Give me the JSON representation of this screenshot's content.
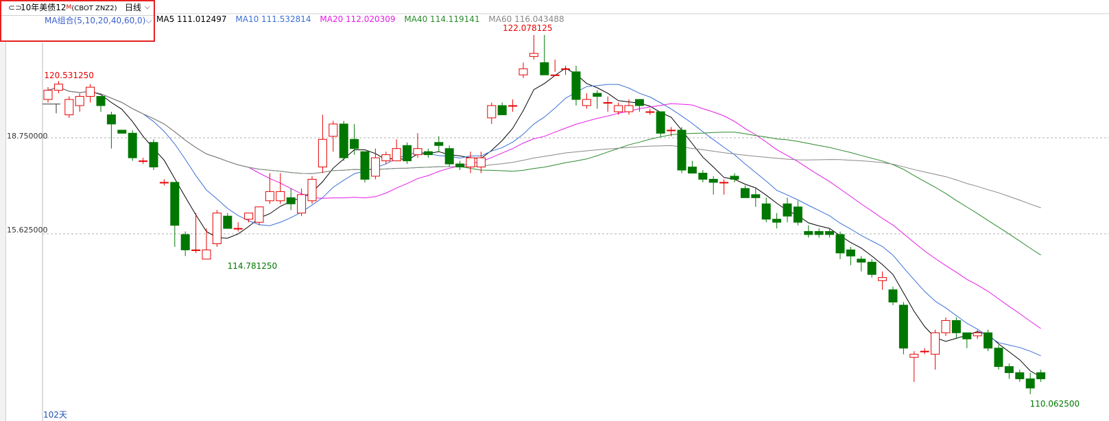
{
  "header": {
    "link_icon": "⊂⊃",
    "instrument": "10年美债12",
    "badge": "M",
    "code": "(CBOT ZNZ2)",
    "period": "日线",
    "chevron": "⌵"
  },
  "ma_combo": "MA组合(5,10,20,40,60,0)⌵",
  "ma_legend": [
    {
      "label": "MA5 111.012497",
      "color": "#000000"
    },
    {
      "label": "MA10 111.532814",
      "color": "#3a6fd8"
    },
    {
      "label": "MA20 112.020309",
      "color": "#e619e6"
    },
    {
      "label": "MA40 114.119141",
      "color": "#2a8a2a"
    },
    {
      "label": "MA60 116.043488",
      "color": "#888888"
    }
  ],
  "day_count": "102天",
  "chart_data": {
    "type": "candlestick",
    "up_color": "#e60000",
    "down_color": "#007700",
    "y_axis": {
      "ticks": [
        {
          "value": 118.75,
          "label": "18.750000"
        },
        {
          "value": 115.625,
          "label": "15.625000"
        }
      ],
      "ylim": [
        109.81,
        123.25
      ]
    },
    "annotations": {
      "high": {
        "value": 122.078125,
        "label": "122.078125",
        "index": 45
      },
      "low_left": {
        "value": 114.78125,
        "label": "114.781250",
        "index": 14
      },
      "left_marker": {
        "value": 120.53125,
        "label": "120.531250",
        "index": 1
      },
      "last_low": {
        "value": 110.0625,
        "label": "110.062500",
        "index": 94
      }
    },
    "candles": [
      [
        120.0,
        120.3,
        120.4,
        119.9
      ],
      [
        120.3,
        120.5,
        120.6,
        120.2
      ],
      [
        119.5,
        120.0,
        120.1,
        119.4
      ],
      [
        119.8,
        120.1,
        120.2,
        119.6
      ],
      [
        120.1,
        120.4,
        120.5,
        119.9
      ],
      [
        120.1,
        119.8,
        120.1,
        119.6
      ],
      [
        119.5,
        119.2,
        119.6,
        118.4
      ],
      [
        119.0,
        118.9,
        119.0,
        118.9
      ],
      [
        118.9,
        118.1,
        119.0,
        118.0
      ],
      [
        118.0,
        118.0,
        118.1,
        117.9
      ],
      [
        118.6,
        117.8,
        118.7,
        117.7
      ],
      [
        117.3,
        117.3,
        117.4,
        117.2
      ],
      [
        117.3,
        115.9,
        117.3,
        115.2
      ],
      [
        115.6,
        115.1,
        115.7,
        114.9
      ],
      [
        115.1,
        115.1,
        116.3,
        115.0
      ],
      [
        114.8,
        115.1,
        115.8,
        114.9
      ],
      [
        115.3,
        116.3,
        116.4,
        115.2
      ],
      [
        116.2,
        115.8,
        116.3,
        115.8
      ],
      [
        115.8,
        115.8,
        116.0,
        115.7
      ],
      [
        116.1,
        116.3,
        116.3,
        116.0
      ],
      [
        116.0,
        116.5,
        116.5,
        115.9
      ],
      [
        116.7,
        117.0,
        117.6,
        116.6
      ],
      [
        116.7,
        117.0,
        117.6,
        116.6
      ],
      [
        116.8,
        116.6,
        117.1,
        116.4
      ],
      [
        116.3,
        116.9,
        117.1,
        116.2
      ],
      [
        116.7,
        117.4,
        117.5,
        116.6
      ],
      [
        117.8,
        118.7,
        119.5,
        117.6
      ],
      [
        118.8,
        119.2,
        119.3,
        118.3
      ],
      [
        119.2,
        118.1,
        119.3,
        118.0
      ],
      [
        118.7,
        118.4,
        119.2,
        118.2
      ],
      [
        118.3,
        117.4,
        118.3,
        117.3
      ],
      [
        117.5,
        118.1,
        118.4,
        117.4
      ],
      [
        118.0,
        118.2,
        118.3,
        117.9
      ],
      [
        118.0,
        118.4,
        118.7,
        118.0
      ],
      [
        118.5,
        118.0,
        118.6,
        117.9
      ],
      [
        118.2,
        118.4,
        118.9,
        118.1
      ],
      [
        118.3,
        118.2,
        118.4,
        118.1
      ],
      [
        118.6,
        118.5,
        118.8,
        118.3
      ],
      [
        118.4,
        117.9,
        118.5,
        117.8
      ],
      [
        117.9,
        117.8,
        118.0,
        117.7
      ],
      [
        117.8,
        118.1,
        118.3,
        117.6
      ],
      [
        117.8,
        118.1,
        118.3,
        117.6
      ],
      [
        119.4,
        119.8,
        119.9,
        119.2
      ],
      [
        119.8,
        119.5,
        119.9,
        119.5
      ],
      [
        119.8,
        119.8,
        120.0,
        119.6
      ],
      [
        120.8,
        121.0,
        121.2,
        120.7
      ],
      [
        121.4,
        121.5,
        122.1,
        121.3
      ],
      [
        121.2,
        120.8,
        122.1,
        120.9
      ],
      [
        120.8,
        120.8,
        121.3,
        120.9
      ],
      [
        121.0,
        121.0,
        121.1,
        120.8
      ],
      [
        120.9,
        120.0,
        121.1,
        119.8
      ],
      [
        119.8,
        120.0,
        120.2,
        119.7
      ],
      [
        120.2,
        120.1,
        120.3,
        119.7
      ],
      [
        119.9,
        119.9,
        120.1,
        119.6
      ],
      [
        119.6,
        119.8,
        119.9,
        119.5
      ],
      [
        119.6,
        119.8,
        120.0,
        119.5
      ],
      [
        120.0,
        119.8,
        120.0,
        119.6
      ],
      [
        119.6,
        119.6,
        119.7,
        119.5
      ],
      [
        119.6,
        118.9,
        119.6,
        118.8
      ],
      [
        119.0,
        119.0,
        119.1,
        118.8
      ],
      [
        119.0,
        117.7,
        119.1,
        117.6
      ],
      [
        117.8,
        117.6,
        118.0,
        117.6
      ],
      [
        117.6,
        117.4,
        117.7,
        117.3
      ],
      [
        117.4,
        117.3,
        117.5,
        116.9
      ],
      [
        117.3,
        117.3,
        117.4,
        116.9
      ],
      [
        117.5,
        117.4,
        117.6,
        117.3
      ],
      [
        117.1,
        116.8,
        117.2,
        116.8
      ],
      [
        116.9,
        116.8,
        117.1,
        116.5
      ],
      [
        116.6,
        116.1,
        116.8,
        116.0
      ],
      [
        116.1,
        116.0,
        116.3,
        115.8
      ],
      [
        116.6,
        116.2,
        116.8,
        116.0
      ],
      [
        116.5,
        116.0,
        116.7,
        115.9
      ],
      [
        115.7,
        115.6,
        115.9,
        115.5
      ],
      [
        115.7,
        115.6,
        115.8,
        115.5
      ],
      [
        115.7,
        115.6,
        115.8,
        115.5
      ],
      [
        115.6,
        115.0,
        115.7,
        114.8
      ],
      [
        115.1,
        114.9,
        115.2,
        114.6
      ],
      [
        114.8,
        114.7,
        114.9,
        114.4
      ],
      [
        114.7,
        114.3,
        114.8,
        114.2
      ],
      [
        114.1,
        114.2,
        114.4,
        113.8
      ],
      [
        113.8,
        113.4,
        113.9,
        113.3
      ],
      [
        113.3,
        111.9,
        113.4,
        111.7
      ],
      [
        111.6,
        111.7,
        111.8,
        110.8
      ],
      [
        111.8,
        111.8,
        111.9,
        111.7
      ],
      [
        111.7,
        112.4,
        112.5,
        111.2
      ],
      [
        112.4,
        112.8,
        112.9,
        112.3
      ],
      [
        112.8,
        112.4,
        112.9,
        112.2
      ],
      [
        112.4,
        112.2,
        112.4,
        111.9
      ],
      [
        112.3,
        112.4,
        112.5,
        112.2
      ],
      [
        112.4,
        111.9,
        112.5,
        111.8
      ],
      [
        111.9,
        111.3,
        112.0,
        111.2
      ],
      [
        111.3,
        111.1,
        111.4,
        110.9
      ],
      [
        111.1,
        110.9,
        111.2,
        110.8
      ],
      [
        110.9,
        110.6,
        111.1,
        110.4
      ],
      [
        111.1,
        110.9,
        111.2,
        110.8
      ]
    ]
  }
}
